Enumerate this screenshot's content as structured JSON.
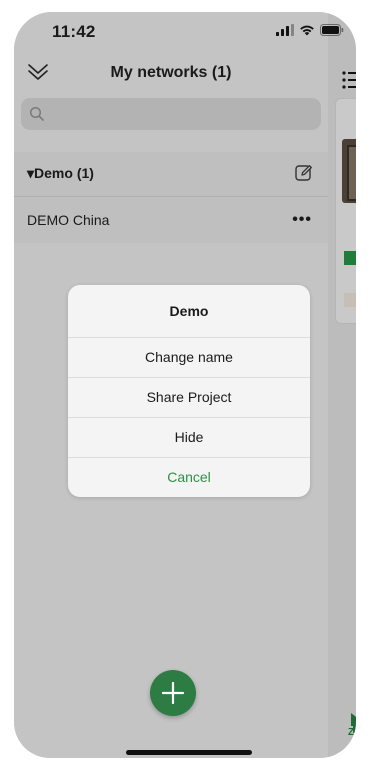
{
  "status_bar": {
    "time": "11:42"
  },
  "header": {
    "title": "My networks (1)"
  },
  "search": {
    "placeholder": ""
  },
  "group": {
    "label": "▾Demo (1)"
  },
  "network": {
    "name": "DEMO China",
    "more": "•••"
  },
  "action_sheet": {
    "title": "Demo",
    "items": [
      "Change name",
      "Share Project",
      "Hide"
    ],
    "cancel": "Cancel"
  },
  "right_panel": {
    "tab_label": "Zo"
  },
  "colors": {
    "accent_green": "#2c7c43",
    "cancel_text": "#2f8f46"
  },
  "icons": [
    "signal-icon",
    "wifi-icon",
    "battery-icon",
    "collapse-chevron-icon",
    "search-icon",
    "edit-icon",
    "more-icon",
    "menu-icon",
    "home-icon",
    "add-icon"
  ]
}
